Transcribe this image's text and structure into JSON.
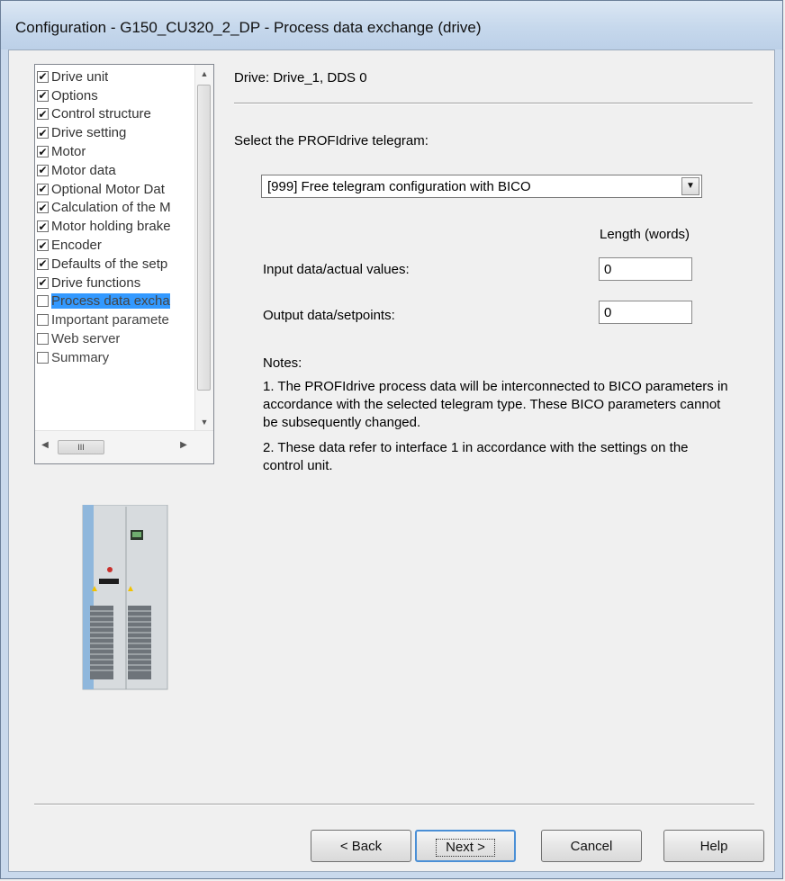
{
  "window": {
    "title": "Configuration - G150_CU320_2_DP - Process data exchange (drive)"
  },
  "tree": {
    "items": [
      {
        "label": "Drive unit",
        "checked": true
      },
      {
        "label": "Options",
        "checked": true
      },
      {
        "label": "Control structure",
        "checked": true
      },
      {
        "label": "Drive setting",
        "checked": true
      },
      {
        "label": "Motor",
        "checked": true
      },
      {
        "label": "Motor data",
        "checked": true
      },
      {
        "label": "Optional Motor Dat",
        "checked": true
      },
      {
        "label": "Calculation of the M",
        "checked": true
      },
      {
        "label": "Motor holding brake",
        "checked": true
      },
      {
        "label": "Encoder",
        "checked": true
      },
      {
        "label": "Defaults of the setp",
        "checked": true
      },
      {
        "label": "Drive functions",
        "checked": true
      },
      {
        "label": "Process data excha",
        "checked": false,
        "selected": true
      },
      {
        "label": "Important paramete",
        "checked": false
      },
      {
        "label": "Web server",
        "checked": false
      },
      {
        "label": "Summary",
        "checked": false
      }
    ],
    "hscroll_grip": "III"
  },
  "main": {
    "drive_label": "Drive: Drive_1, DDS 0",
    "select_prompt": "Select the PROFIdrive telegram:",
    "telegram_value": "[999] Free telegram configuration with BICO",
    "length_header": "Length (words)",
    "input_label": "Input data/actual values:",
    "input_value": "0",
    "output_label": "Output data/setpoints:",
    "output_value": "0",
    "notes_title": "Notes:",
    "note1": "1. The PROFIdrive process data will be interconnected to BICO parameters in accordance with the selected telegram type. These BICO parameters cannot be subsequently changed.",
    "note2": "2. These data refer to interface 1 in accordance with the settings on the control unit."
  },
  "buttons": {
    "back": "< Back",
    "next": "Next >",
    "cancel": "Cancel",
    "help": "Help"
  },
  "colors": {
    "selection": "#3399ff",
    "title_bar": "#c6d8ec",
    "default_button_border": "#4a8fd6"
  }
}
